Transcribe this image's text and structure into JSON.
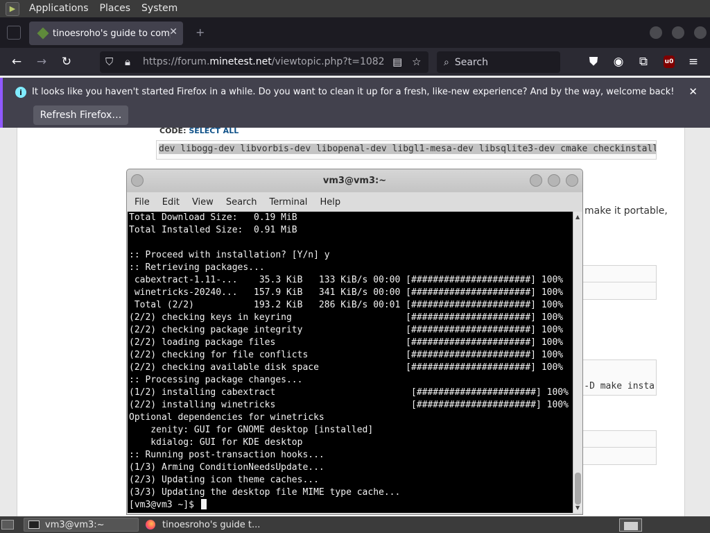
{
  "top_panel": {
    "menus": [
      "Applications",
      "Places",
      "System"
    ]
  },
  "firefox": {
    "tab_title": "tinoesroho's guide to compiling",
    "url_rest": "https://forum.",
    "url_domain": "minetest.net",
    "url_path": "/viewtopic.php?t=1082",
    "search_placeholder": "Search",
    "notification_text": "It looks like you haven't started Firefox in a while. Do you want to clean it up for a fresh, like-new experience? And by the way, welcome back!",
    "refresh_button": "Refresh Firefox…"
  },
  "webpage": {
    "code_label": "CODE:",
    "select_all": "SELECT ALL",
    "code_line": "dev libogg-dev libvorbis-dev libopenal-dev libgl1-mesa-dev libsqlite3-dev cmake checkinstall",
    "partial_text": "make it portable,",
    "code_line_2": "-D make insta"
  },
  "terminal": {
    "title": "vm3@vm3:~",
    "menu": [
      "File",
      "Edit",
      "View",
      "Search",
      "Terminal",
      "Help"
    ],
    "lines": [
      "Total Download Size:   0.19 MiB",
      "Total Installed Size:  0.91 MiB",
      "",
      ":: Proceed with installation? [Y/n] y",
      ":: Retrieving packages...",
      " cabextract-1.11-...    35.3 KiB   133 KiB/s 00:00 [######################] 100%",
      " winetricks-20240...   157.9 KiB   341 KiB/s 00:00 [######################] 100%",
      " Total (2/2)           193.2 KiB   286 KiB/s 00:01 [######################] 100%",
      "(2/2) checking keys in keyring                     [######################] 100%",
      "(2/2) checking package integrity                   [######################] 100%",
      "(2/2) loading package files                        [######################] 100%",
      "(2/2) checking for file conflicts                  [######################] 100%",
      "(2/2) checking available disk space                [######################] 100%",
      ":: Processing package changes...",
      "(1/2) installing cabextract                         [######################] 100%",
      "(2/2) installing winetricks                         [######################] 100%",
      "Optional dependencies for winetricks",
      "    zenity: GUI for GNOME desktop [installed]",
      "    kdialog: GUI for KDE desktop",
      ":: Running post-transaction hooks...",
      "(1/3) Arming ConditionNeedsUpdate...",
      "(2/3) Updating icon theme caches...",
      "(3/3) Updating the desktop file MIME type cache..."
    ],
    "prompt": "[vm3@vm3 ~]$ "
  },
  "taskbar": {
    "items": [
      "vm3@vm3:~",
      "tinoesroho's guide t..."
    ]
  }
}
